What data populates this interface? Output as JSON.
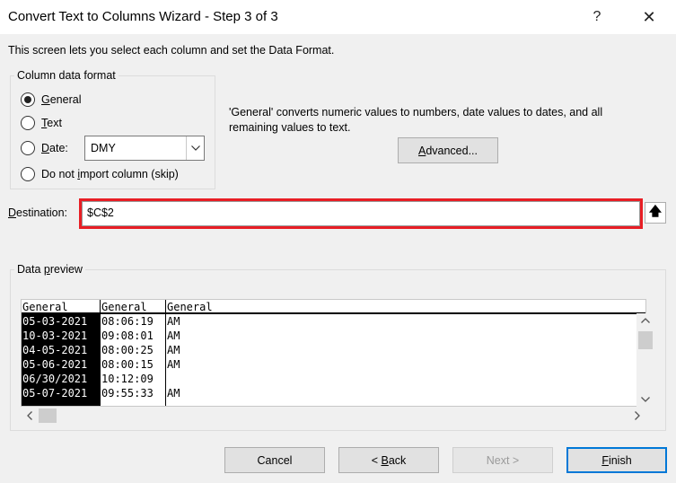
{
  "window": {
    "title": "Convert Text to Columns Wizard - Step 3 of 3",
    "help_glyph": "?",
    "close_glyph": "✕"
  },
  "intro_text": "This screen lets you select each column and set the Data Format.",
  "format_group": {
    "legend": "Column data format",
    "options": [
      {
        "pre": "",
        "key": "G",
        "post": "eneral",
        "selected": true
      },
      {
        "pre": "",
        "key": "T",
        "post": "ext",
        "selected": false
      },
      {
        "pre": "",
        "key": "D",
        "post": "ate:",
        "selected": false
      },
      {
        "pre": "Do not ",
        "key": "i",
        "post": "mport column (skip)",
        "selected": false
      }
    ],
    "date_format": "DMY"
  },
  "description": "'General' converts numeric values to numbers, date values to dates, and all remaining values to text.",
  "advanced_button": {
    "pre": "",
    "key": "A",
    "post": "dvanced..."
  },
  "destination": {
    "label_key": "D",
    "label_rest": "estination:",
    "value": "$C$2",
    "collapse_glyph": "🡅"
  },
  "preview": {
    "legend_pre": "Data ",
    "legend_key": "p",
    "legend_post": "review",
    "headers": [
      "General",
      "General",
      "General"
    ],
    "col1": [
      "05-03-2021",
      "10-03-2021",
      "04-05-2021",
      "05-06-2021",
      "06/30/2021",
      "05-07-2021"
    ],
    "col2": [
      "08:06:19",
      "09:08:01",
      "08:00:25",
      "08:00:15",
      "10:12:09",
      "09:55:33"
    ],
    "col3": [
      "AM",
      "AM",
      "AM",
      "AM",
      "",
      "AM"
    ]
  },
  "buttons": {
    "cancel": "Cancel",
    "back_pre": "< ",
    "back_key": "B",
    "back_post": "ack",
    "next": "Next >",
    "finish_key": "F",
    "finish_post": "inish"
  },
  "colors": {
    "highlight": "#e81e25",
    "focus": "#0078d7"
  }
}
